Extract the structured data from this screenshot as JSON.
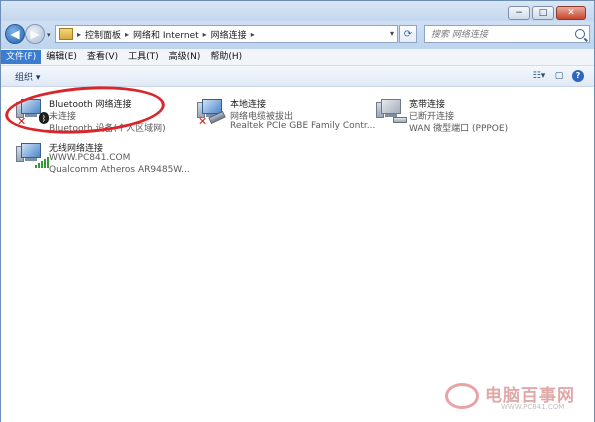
{
  "window": {
    "caption_buttons": [
      "−",
      "□",
      "✕"
    ]
  },
  "nav": {
    "back_icon": "back-arrow-icon",
    "forward_icon": "forward-arrow-icon"
  },
  "address": {
    "breadcrumbs": [
      "控制面板",
      "网络和 Internet",
      "网络连接"
    ],
    "refresh_icon": "refresh-icon"
  },
  "search": {
    "placeholder": "搜索 网络连接"
  },
  "menu": {
    "items": [
      "文件(F)",
      "编辑(E)",
      "查看(V)",
      "工具(T)",
      "高级(N)",
      "帮助(H)"
    ]
  },
  "toolbar": {
    "organize_label": "组织 ▾",
    "view_icon": "view-options-icon",
    "preview_icon": "preview-pane-icon",
    "help_label": "?"
  },
  "connections": [
    {
      "name": "Bluetooth 网络连接",
      "status": "未连接",
      "device": "Bluetooth 设备(个人区域网)"
    },
    {
      "name": "本地连接",
      "status": "网络电缆被拔出",
      "device": "Realtek PCIe GBE Family Contr..."
    },
    {
      "name": "宽带连接",
      "status": "已断开连接",
      "device": "WAN 微型端口 (PPPOE)"
    },
    {
      "name": "无线网络连接",
      "status": "WWW.PC841.COM",
      "device": "Qualcomm Atheros AR9485W..."
    }
  ],
  "watermark": {
    "title": "电脑百事网",
    "url": "WWW.PC841.COM"
  },
  "colors": {
    "accent": "#3b7bd0",
    "annotation_ring": "#d9262b",
    "disconnected_x": "#c8271d",
    "wifi_signal": "#2f9a36"
  }
}
